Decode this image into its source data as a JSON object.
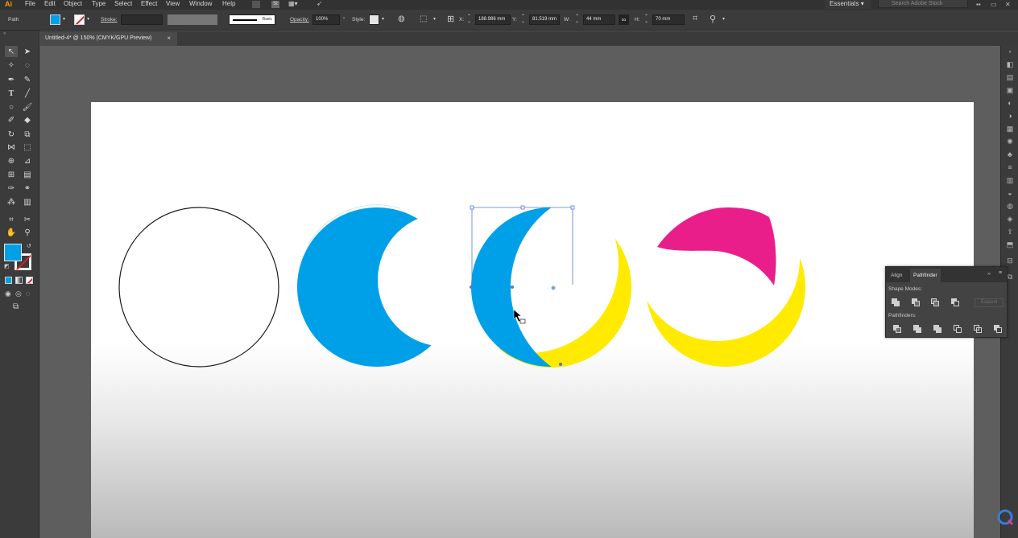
{
  "app": {
    "logo": "Ai",
    "menu": [
      "File",
      "Edit",
      "Object",
      "Type",
      "Select",
      "Effect",
      "View",
      "Window",
      "Help"
    ],
    "workspace": "Essentials",
    "stock_search_placeholder": "Search Adobe Stock"
  },
  "control_bar": {
    "selection_type": "Path",
    "fill_color": "#00a0e9",
    "stroke_label": "Stroke:",
    "brush_label": "Basic",
    "opacity_label": "Opacity:",
    "opacity_value": "100%",
    "style_label": "Style:",
    "x_label": "X:",
    "x_value": "188.986 mm",
    "y_label": "Y:",
    "y_value": "81.519 mm",
    "w_label": "W:",
    "w_value": "44 mm",
    "h_label": "H:",
    "h_value": "70 mm"
  },
  "document": {
    "tab_title": "Untitled-4* @ 150% (CMYK/GPU Preview)",
    "tab_close": "×"
  },
  "artwork": {
    "cyan": "#00a0e9",
    "yellow": "#ffea00",
    "magenta": "#ea1e8b",
    "selection": "#4c7bd4"
  },
  "pathfinder_panel": {
    "tabs": [
      "Align",
      "Pathfinder"
    ],
    "active_tab": "Pathfinder",
    "shape_modes_label": "Shape Modes:",
    "pathfinders_label": "Pathfinders:",
    "expand_label": "Expand"
  }
}
